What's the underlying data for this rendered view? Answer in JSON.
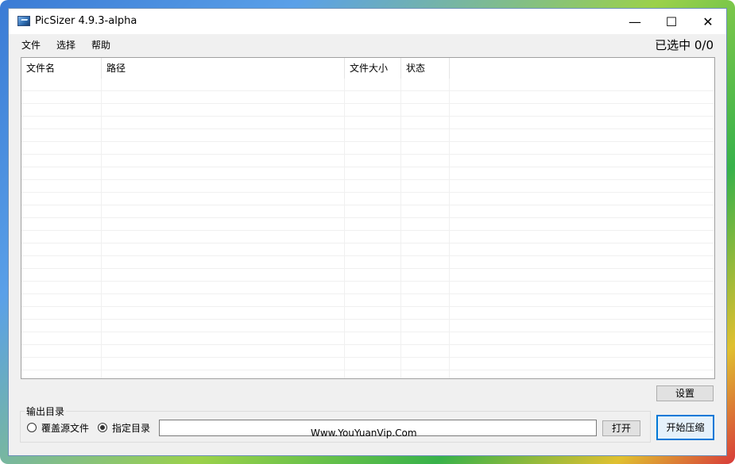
{
  "window": {
    "title": "PicSizer 4.9.3-alpha",
    "minimize_glyph": "—",
    "maximize_glyph": "☐",
    "close_glyph": "✕"
  },
  "menu": {
    "items": [
      "文件",
      "选择",
      "帮助"
    ],
    "selected_count": "已选中 0/0"
  },
  "table": {
    "columns": [
      "文件名",
      "路径",
      "文件大小",
      "状态"
    ],
    "rows": []
  },
  "buttons": {
    "settings": "设置",
    "open": "打开",
    "start": "开始压缩"
  },
  "output": {
    "group_label": "输出目录",
    "option_overwrite": "覆盖源文件",
    "option_specify": "指定目录",
    "selected_option": "指定目录",
    "path_value": ""
  },
  "watermark": "Www.YouYuanVip.Com",
  "colors": {
    "accent": "#0078d7",
    "button_face": "#e1e1e1",
    "window_bg": "#f0f0f0"
  }
}
